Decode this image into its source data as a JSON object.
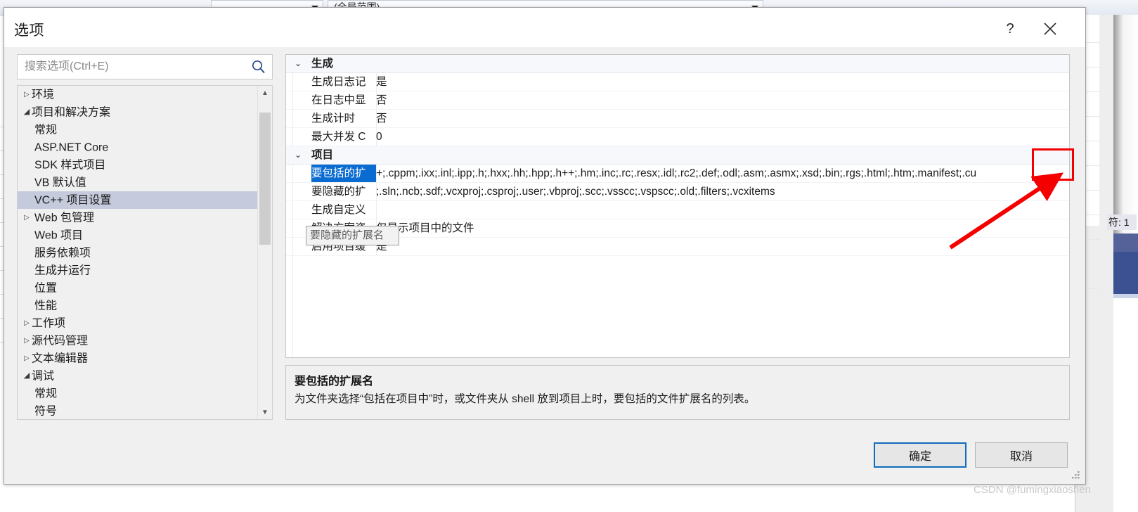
{
  "background": {
    "combo_global_scope": "(全局范围)",
    "status_fragment": "符: 1"
  },
  "dialog": {
    "title": "选项",
    "help_icon": "question-mark-icon",
    "close_icon": "close-x-icon",
    "search": {
      "placeholder": "搜索选项(Ctrl+E)",
      "value": "",
      "icon": "search-magnifier-icon"
    },
    "tree": {
      "items": [
        {
          "label": "环境",
          "level": 0,
          "state": "collapsed",
          "selected": false
        },
        {
          "label": "项目和解决方案",
          "level": 0,
          "state": "expanded",
          "selected": false
        },
        {
          "label": "常规",
          "level": 1,
          "state": "leaf",
          "selected": false
        },
        {
          "label": "ASP.NET Core",
          "level": 1,
          "state": "leaf",
          "selected": false
        },
        {
          "label": "SDK 样式项目",
          "level": 1,
          "state": "leaf",
          "selected": false
        },
        {
          "label": "VB 默认值",
          "level": 1,
          "state": "leaf",
          "selected": false
        },
        {
          "label": "VC++ 项目设置",
          "level": 1,
          "state": "leaf",
          "selected": true
        },
        {
          "label": "Web 包管理",
          "level": 1,
          "state": "collapsed",
          "selected": false
        },
        {
          "label": "Web 项目",
          "level": 1,
          "state": "leaf",
          "selected": false
        },
        {
          "label": "服务依赖项",
          "level": 1,
          "state": "leaf",
          "selected": false
        },
        {
          "label": "生成并运行",
          "level": 1,
          "state": "leaf",
          "selected": false
        },
        {
          "label": "位置",
          "level": 1,
          "state": "leaf",
          "selected": false
        },
        {
          "label": "性能",
          "level": 1,
          "state": "leaf",
          "selected": false
        },
        {
          "label": "工作项",
          "level": 0,
          "state": "collapsed",
          "selected": false
        },
        {
          "label": "源代码管理",
          "level": 0,
          "state": "collapsed",
          "selected": false
        },
        {
          "label": "文本编辑器",
          "level": 0,
          "state": "collapsed",
          "selected": false
        },
        {
          "label": "调试",
          "level": 0,
          "state": "expanded",
          "selected": false
        },
        {
          "label": "常规",
          "level": 1,
          "state": "leaf",
          "selected": false
        },
        {
          "label": "符号",
          "level": 1,
          "state": "leaf",
          "selected": false
        }
      ]
    },
    "property_grid": {
      "rows": [
        {
          "kind": "category",
          "chevron": "⌄",
          "name": "生成"
        },
        {
          "kind": "property",
          "name": "生成日志记",
          "value": "是",
          "selected": false
        },
        {
          "kind": "property",
          "name": "在日志中显",
          "value": "否",
          "selected": false
        },
        {
          "kind": "property",
          "name": "生成计时",
          "value": "否",
          "selected": false
        },
        {
          "kind": "property",
          "name": "最大并发 C",
          "value": "0",
          "selected": false
        },
        {
          "kind": "category",
          "chevron": "⌄",
          "name": "项目"
        },
        {
          "kind": "property",
          "name": "要包括的扩",
          "value": "+;.cppm;.ixx;.inl;.ipp;.h;.hxx;.hh;.hpp;.h++;.hm;.inc;.rc;.resx;.idl;.rc2;.def;.odl;.asm;.asmx;.xsd;.bin;.rgs;.html;.htm;.manifest;.cu",
          "selected": true
        },
        {
          "kind": "property",
          "name": "要隐藏的扩",
          "value": ";.sln;.ncb;.sdf;.vcxproj;.csproj;.user;.vbproj;.scc;.vsscc;.vspscc;.old;.filters;.vcxitems",
          "selected": false
        },
        {
          "kind": "property",
          "name": "生成自定义",
          "value": "",
          "selected": false
        },
        {
          "kind": "property",
          "name": "解决方案资",
          "value": "仅显示项目中的文件",
          "selected": false
        },
        {
          "kind": "property",
          "name": "启用项目缓",
          "value": "是",
          "selected": false
        }
      ],
      "tooltip": "要隐藏的扩展名"
    },
    "description": {
      "title": "要包括的扩展名",
      "body": "为文件夹选择“包括在项目中”时，或文件夹从 shell 放到项目上时，要包括的文件扩展名的列表。"
    },
    "footer": {
      "ok_label": "确定",
      "cancel_label": "取消"
    }
  },
  "annotation": {
    "highlight_color": "#f40000",
    "arrow_color": "#f40000"
  },
  "watermark": "CSDN @fumingxiaoshen"
}
